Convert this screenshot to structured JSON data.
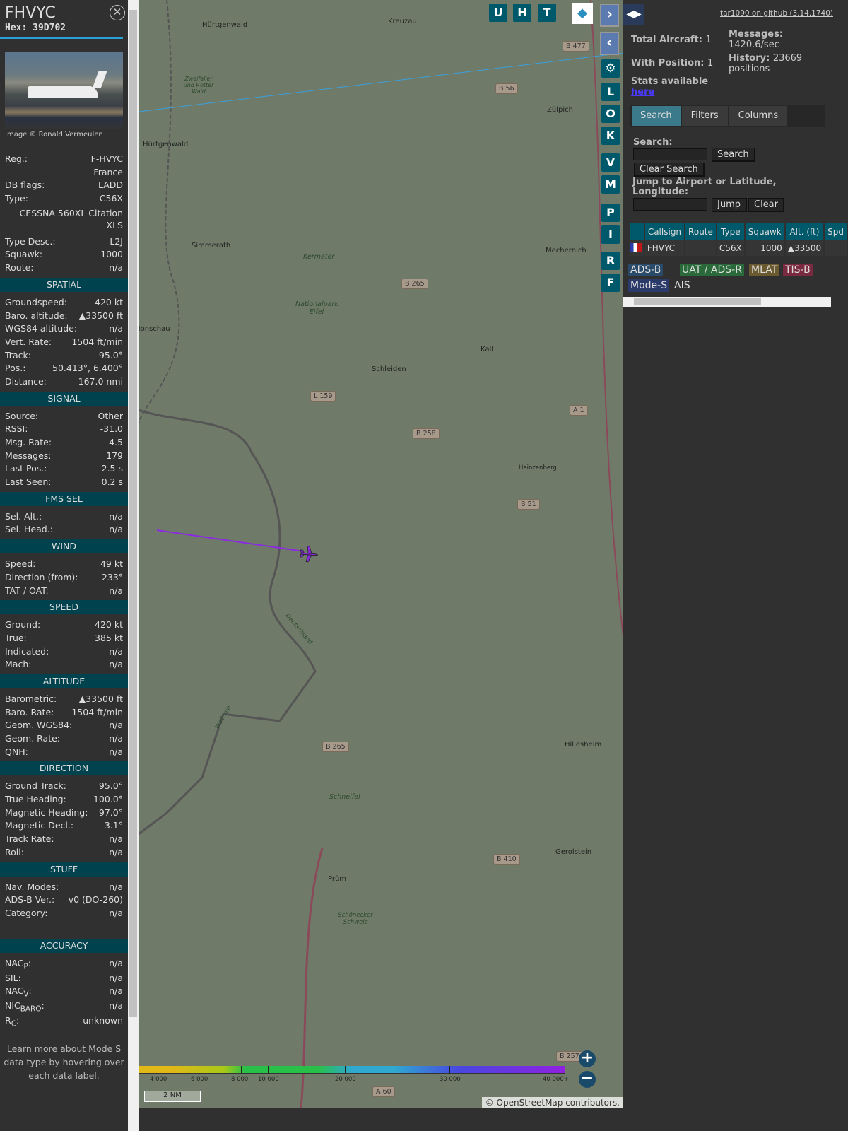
{
  "aircraft": {
    "callsign": "FHVYC",
    "hex_label": "Hex:",
    "hex": "39D702",
    "image_credit": "Image © Ronald Vermeulen"
  },
  "info_rows": [
    {
      "label": "Reg.:",
      "value": "F-HVYC"
    },
    {
      "label": "",
      "value": "France"
    },
    {
      "label": "DB flags:",
      "value": "LADD"
    },
    {
      "label": "Type:",
      "value": "C56X"
    },
    {
      "label": "",
      "value": "CESSNA 560XL Citation XLS"
    },
    {
      "label": "Type Desc.:",
      "value": "L2J"
    },
    {
      "label": "Squawk:",
      "value": "1000"
    },
    {
      "label": "Route:",
      "value": "n/a"
    }
  ],
  "sections": [
    {
      "title": "SPATIAL",
      "rows": [
        [
          "Groundspeed:",
          "420 kt"
        ],
        [
          "Baro. altitude:",
          "▲33500 ft"
        ],
        [
          "WGS84 altitude:",
          "n/a"
        ],
        [
          "Vert. Rate:",
          "1504 ft/min"
        ],
        [
          "Track:",
          "95.0°"
        ],
        [
          "Pos.:",
          "50.413°, 6.400°"
        ],
        [
          "Distance:",
          "167.0 nmi"
        ]
      ]
    },
    {
      "title": "SIGNAL",
      "rows": [
        [
          "Source:",
          "Other"
        ],
        [
          "RSSI:",
          "-31.0"
        ],
        [
          "Msg. Rate:",
          "4.5"
        ],
        [
          "Messages:",
          "179"
        ],
        [
          "Last Pos.:",
          "2.5 s"
        ],
        [
          "Last Seen:",
          "0.2 s"
        ]
      ]
    },
    {
      "title": "FMS SEL",
      "rows": [
        [
          "Sel. Alt.:",
          "n/a"
        ],
        [
          "Sel. Head.:",
          "n/a"
        ]
      ]
    },
    {
      "title": "WIND",
      "rows": [
        [
          "Speed:",
          "49 kt"
        ],
        [
          "Direction (from):",
          "233°"
        ],
        [
          "TAT / OAT:",
          "n/a"
        ]
      ]
    },
    {
      "title": "SPEED",
      "rows": [
        [
          "Ground:",
          "420 kt"
        ],
        [
          "True:",
          "385 kt"
        ],
        [
          "Indicated:",
          "n/a"
        ],
        [
          "Mach:",
          "n/a"
        ]
      ]
    },
    {
      "title": "ALTITUDE",
      "rows": [
        [
          "Barometric:",
          "▲33500 ft"
        ],
        [
          "Baro. Rate:",
          "1504 ft/min"
        ],
        [
          "Geom. WGS84:",
          "n/a"
        ],
        [
          "Geom. Rate:",
          "n/a"
        ],
        [
          "QNH:",
          "n/a"
        ]
      ]
    },
    {
      "title": "DIRECTION",
      "rows": [
        [
          "Ground Track:",
          "95.0°"
        ],
        [
          "True Heading:",
          "100.0°"
        ],
        [
          "Magnetic Heading:",
          "97.0°"
        ],
        [
          "Magnetic Decl.:",
          "3.1°"
        ],
        [
          "Track Rate:",
          "n/a"
        ],
        [
          "Roll:",
          "n/a"
        ]
      ]
    },
    {
      "title": "STUFF",
      "rows": [
        [
          "Nav. Modes:",
          "n/a"
        ],
        [
          "ADS-B Ver.:",
          "v0 (DO-260)"
        ],
        [
          "Category:",
          "n/a"
        ]
      ]
    }
  ],
  "accuracy": {
    "title": "ACCURACY",
    "nacp": "NAC",
    "nacp_sub": "P",
    "nacp_v": "n/a",
    "sil": "SIL:",
    "sil_v": "n/a",
    "nacv": "NAC",
    "nacv_sub": "V",
    "nacv_v": "n/a",
    "nic": "NIC",
    "nic_sub": "BARO",
    "nic_v": "n/a",
    "rc": "R",
    "rc_sub": "C",
    "rc_v": "unknown",
    "colon": ":"
  },
  "help_note": "Learn more about Mode S data type by hovering over each data label.",
  "map": {
    "buttons_top": [
      "U",
      "H",
      "T"
    ],
    "buttons_side": [
      "L",
      "O",
      "K",
      "V",
      "M",
      "P",
      "I",
      "R",
      "F"
    ],
    "labels": [
      "Kreuzau",
      "Hürtgenwald",
      "Zülpich",
      "Hürtgenwald",
      "Simmerath",
      "Mechernich",
      "Kall",
      "Schleiden",
      "Heinzenberg",
      "Hillesheim",
      "Prüm",
      "Gerolstein",
      "Monschau",
      "Kermeter",
      "Nationalpark Eifel",
      "Zweifaller und Rotter Wald",
      "Schneifel",
      "Schönecker Schweiz",
      "Deutschland",
      "Wallonie"
    ],
    "roads": [
      "B 477",
      "B 56",
      "B 265",
      "L 159",
      "B 258",
      "A 1",
      "B 51",
      "B 265",
      "B 410",
      "B 257",
      "A 60"
    ],
    "altitude_scale": [
      "4 000",
      "6 000",
      "8 000",
      "10 000",
      "20 000",
      "30 000",
      "40 000+"
    ],
    "scale_bar": "2 NM",
    "attribution": "© OpenStreetMap contributors."
  },
  "right": {
    "github": "tar1090 on github (3.14.1740)",
    "total_label": "Total Aircraft:",
    "total": "1",
    "withpos_label": "With Position:",
    "withpos": "1",
    "messages_label": "Messages:",
    "messages": "1420.6/sec",
    "history_label": "History:",
    "history": "23669 positions",
    "stats_label": "Stats available",
    "stats_link": "here",
    "tabs": [
      "Search",
      "Filters",
      "Columns"
    ],
    "search_label": "Search:",
    "search_btn": "Search",
    "clear_search_btn": "Clear Search",
    "jump_label": "Jump to Airport or Latitude, Longitude:",
    "jump_btn": "Jump",
    "clear_btn": "Clear",
    "columns": [
      "",
      "Callsign",
      "Route",
      "Type",
      "Squawk",
      "Alt. (ft)",
      "Spd"
    ],
    "row": {
      "callsign": "FHVYC",
      "route": "",
      "type": "C56X",
      "squawk": "1000",
      "alt": "▲33500",
      "spd": ""
    },
    "sources": [
      "ADS-B",
      "UAT / ADS-R",
      "MLAT",
      "TIS-B",
      "Mode-S",
      "AIS"
    ]
  },
  "colors": {
    "accent": "#00596b",
    "section": "#00434f",
    "track": "#8a2be2"
  }
}
